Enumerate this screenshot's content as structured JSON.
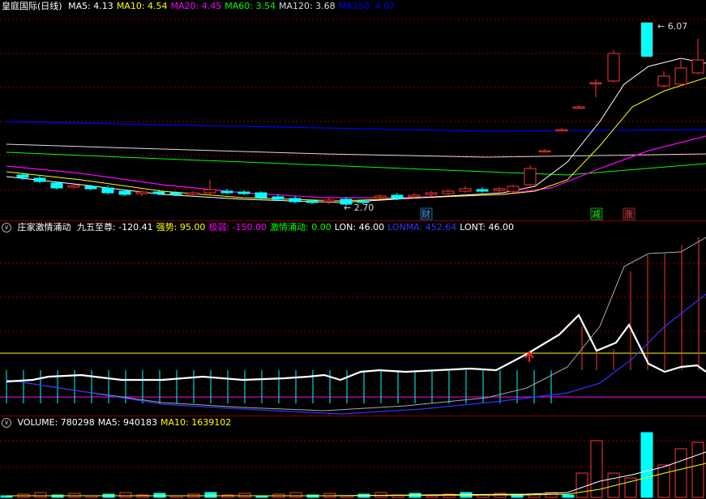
{
  "main": {
    "title": "皇庭国际(日线)",
    "indicators": [
      {
        "label": "MA5: 4.13",
        "color": "#ffffff"
      },
      {
        "label": "MA10: 4.54",
        "color": "#ffff00"
      },
      {
        "label": "MA20: 4.45",
        "color": "#ff00ff"
      },
      {
        "label": "MA60: 3.54",
        "color": "#00ff00"
      },
      {
        "label": "MA120: 3.68",
        "color": "#dcdcdc"
      },
      {
        "label": "MA250: 4.07",
        "color": "#0000ff"
      }
    ],
    "high_label": "6.07",
    "low_label": "2.70",
    "markers": [
      {
        "text": "财",
        "color": "#3399ff"
      },
      {
        "text": "减",
        "color": "#00ff00"
      },
      {
        "text": "涨",
        "color": "#ff3333"
      }
    ]
  },
  "indicator_pane": {
    "title": "庄家激情涌动",
    "values": [
      {
        "label": "九五至尊: -120.41",
        "color": "#ffffff"
      },
      {
        "label": "强势: 95.00",
        "color": "#ffff00"
      },
      {
        "label": "极弱: -150.00",
        "color": "#ff00ff"
      },
      {
        "label": "激情涌动: 0.00",
        "color": "#00ff00"
      },
      {
        "label": "LON: 46.00",
        "color": "#ffffff"
      },
      {
        "label": "LONMA: 452.64",
        "color": "#3333ff"
      },
      {
        "label": "LONT: 46.00",
        "color": "#ffffff"
      }
    ]
  },
  "volume_pane": {
    "values": [
      {
        "label": "VOLUME: 780298",
        "color": "#ffffff"
      },
      {
        "label": "MA5: 940183",
        "color": "#ffffff"
      },
      {
        "label": "MA10: 1639102",
        "color": "#ffff00"
      }
    ]
  },
  "colors": {
    "up": "#ff3333",
    "down": "#00ffff",
    "grid": "#8b0000"
  }
}
